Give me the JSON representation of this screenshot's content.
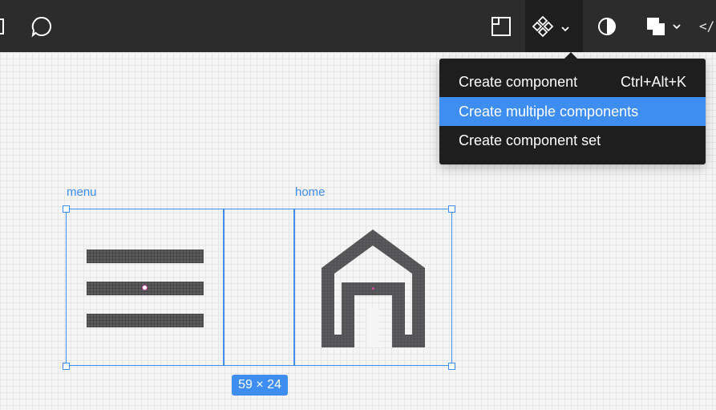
{
  "toolbar": {
    "icons": [
      "hand-icon",
      "comment-icon",
      "frame-icon",
      "component-icon",
      "chevron-down-icon",
      "contrast-icon",
      "boolean-shapes-icon",
      "code-icon"
    ],
    "code_label": "</"
  },
  "dropdown": {
    "items": [
      {
        "label": "Create component",
        "shortcut": "Ctrl+Alt+K",
        "highlighted": false
      },
      {
        "label": "Create multiple components",
        "shortcut": "",
        "highlighted": true
      },
      {
        "label": "Create component set",
        "shortcut": "",
        "highlighted": false
      }
    ]
  },
  "canvas": {
    "frames": [
      {
        "label": "menu"
      },
      {
        "label": "home"
      }
    ],
    "selection_size": "59 × 24"
  },
  "colors": {
    "toolbar_bg": "#2c2c2c",
    "menu_bg": "#1e1e1e",
    "accent": "#3d8ef0",
    "icon_fill": "#5a5a5c"
  }
}
